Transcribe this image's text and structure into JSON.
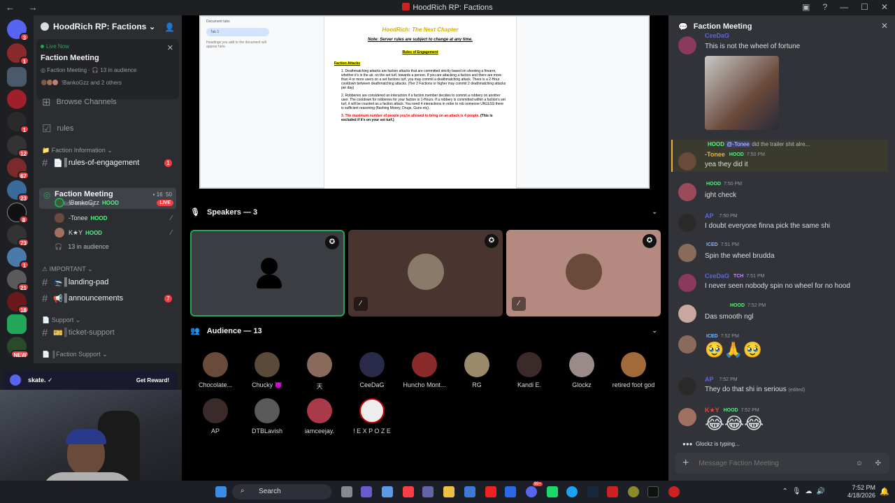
{
  "window": {
    "title": "HoodRich RP: Factions",
    "nav": "← →"
  },
  "server": {
    "name": "HoodRich RP: Factions"
  },
  "live_card": {
    "status": "Live Now",
    "title": "Faction Meeting",
    "channel": "Faction Meeting",
    "audience": "13 in audience",
    "others": "!BankoGzz and 2 others"
  },
  "channels": {
    "browse": "Browse Channels",
    "rules": "rules",
    "cat_info": "Faction Information",
    "rules_eng": "║rules-of-engagement",
    "rules_eng_badge": "1",
    "vc_name": "Faction Meeting",
    "vc_sub": "Faction Meeting",
    "vc_count_a": "16",
    "vc_count_b": "50",
    "vc_users": [
      {
        "name": "!BankoGzz",
        "role": "HOOD",
        "badge": "LIVE"
      },
      {
        "name": "-Tonee",
        "role": "HOOD"
      },
      {
        "name": "K★Y",
        "role": "HOOD"
      }
    ],
    "vc_audience": "13 in audience",
    "cat_important": "IMPORTANT",
    "landing": "║landing-pad",
    "announcements": "║announcements",
    "ann_badge": "7",
    "cat_support": "Support",
    "ticket": "║ticket-support",
    "cat_fsupport": "║Faction Support"
  },
  "ad": {
    "brand": "skate.",
    "cta": "Get Reward!"
  },
  "doc": {
    "tabs_label": "Document tabs",
    "tab1": "Tab 1",
    "tabs_hint": "Headings you add to the document will appear here.",
    "title": "HoodRich: The Next Chapter",
    "note": "Note: Server rules are subject to change at any time.",
    "rules_heading": "Rules of Engagement",
    "faction_attacks": "Faction Attacks",
    "p1": "1. Deathmatching attacks are faction attacks that are committed strictly based on shooting a firearm, whether it's in the air, on the set turf, towards a person. If you are attacking a faction and there are more than 4 or more users on a set factions turf, you may commit a deathmatching attack. There is a 2-Hour cooldown between deathmatching attacks. (Tier 2 Factions or higher may commit 2 deathmatching attacks per day)",
    "p2": "2. Robberies are considered an interaction if a faction member decides to commit a robbery on another user. The cooldown for robberies for your faction is 1-Hours. If a robbery is committed within a faction's set turf, it will be counted as a faction attack. You need 4 interactions in order to rob someone UNLESS there is sufficient reasoning (flashing Money, Drugs, Guns etc).",
    "p3_red": "3. The maximum number of people you're allowed to bring on an attack is 4 people.",
    "p3_rest": " (This is excluded if it's on your set turf.)"
  },
  "speakers": {
    "label": "Speakers — 3"
  },
  "audience": {
    "label": "Audience — 13",
    "members": [
      "Chocolate...",
      "Chucky 👿",
      "天",
      "CeeDaG",
      "Huncho Mont...",
      "RG",
      "Kandi E.",
      "Glockz",
      "retired foot god",
      "AP",
      "DTBLavish",
      "iamceejay.",
      "! E X P O Z E"
    ]
  },
  "chat": {
    "title": "Faction Meeting",
    "messages": [
      {
        "name": "CeeDaG",
        "text": "This is not the wheel of fortune"
      },
      {
        "reply_role": "HOOD",
        "reply_mention": "@-Tonee",
        "reply_text": "did the trailer shit alre...",
        "name": "-Tonee",
        "role": "HOOD",
        "time": "7:50 PM",
        "text": "yea they did it"
      },
      {
        "role": "HOOD",
        "time": "7:50 PM",
        "text": "ight check"
      },
      {
        "name": "AP",
        "time": "7:50 PM",
        "text": "I doubt everyone finna pick the same shi"
      },
      {
        "role": "ICED",
        "time": "7:51 PM",
        "text": "Spin the wheel brudda"
      },
      {
        "name": "CeeDaG",
        "role": "TCH",
        "time": "7:51 PM",
        "text": "I never seen nobody spin no wheel for no hood"
      },
      {
        "role": "HOOD",
        "time": "7:52 PM",
        "text": "Das smooth ngl"
      },
      {
        "role": "ICED",
        "time": "7:52 PM",
        "text": "🥹🙏🥹"
      },
      {
        "name": "AP",
        "time": "7:52 PM",
        "text": "They do that shi in serious",
        "edited": "(edited)"
      },
      {
        "name": "K★Y",
        "role": "HOOD",
        "time": "7:52 PM",
        "text": "😂😂😂"
      }
    ],
    "typing": "Glockz is typing...",
    "placeholder": "Message Faction Meeting"
  },
  "taskbar": {
    "search": "Search",
    "time": "7:52 PM",
    "date": "4/18/2026",
    "discord_badge": "99+"
  }
}
